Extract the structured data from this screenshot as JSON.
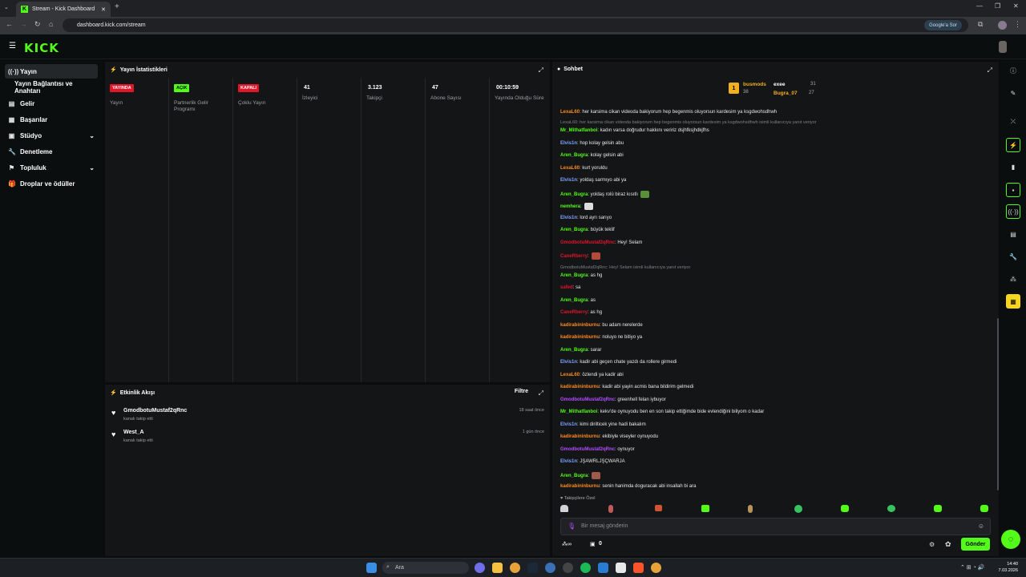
{
  "browser": {
    "tab_title": "Stream - Kick Dashboard",
    "url": "dashboard.kick.com/stream",
    "google_sor": "Google'a Sor"
  },
  "app": {
    "logo": "KICK"
  },
  "sidebar": {
    "items": [
      {
        "label": "Yayın",
        "icon": "broadcast-icon"
      },
      {
        "label": "Yayın Bağlantısı ve Anahtarı",
        "icon": ""
      },
      {
        "label": "Gelir",
        "icon": "revenue-icon"
      },
      {
        "label": "Başarılar",
        "icon": "achievements-icon"
      },
      {
        "label": "Stüdyo",
        "icon": "studio-icon"
      },
      {
        "label": "Denetleme",
        "icon": "moderation-icon"
      },
      {
        "label": "Topluluk",
        "icon": "community-icon"
      },
      {
        "label": "Droplar ve ödüller",
        "icon": "gift-icon"
      }
    ]
  },
  "stats": {
    "title": "Yayın İstatistikleri",
    "columns": [
      {
        "badge": "YAYINDA",
        "label": "Yayın",
        "badge_color": "#e0162b"
      },
      {
        "badge": "AÇIK",
        "label": "Partnerlik Gelir Programı",
        "badge_color": "#53fc18"
      },
      {
        "badge": "KAPALI",
        "label": "Çoklu Yayın",
        "badge_color": "#e0162b"
      },
      {
        "value": "41",
        "label": "İzleyici"
      },
      {
        "value": "3.123",
        "label": "Takipçi"
      },
      {
        "value": "47",
        "label": "Abone Sayısı"
      },
      {
        "value": "00:10:59",
        "label": "Yayında Olduğu Süre"
      }
    ]
  },
  "events": {
    "title": "Etkinlik Akışı",
    "filter": "Filtre",
    "items": [
      {
        "name": "GmodbotuMustaf2qRnc",
        "sub": "kanalı takip etti",
        "time": "18 saat önce"
      },
      {
        "name": "West_A",
        "sub": "kanalı takip etti",
        "time": "1 gün önce"
      }
    ]
  },
  "chat": {
    "title": "Sohbet",
    "leaderboard": {
      "rank": "1",
      "first": {
        "name": "busmods",
        "value": "38"
      },
      "second": {
        "name": "exee",
        "value": "31"
      },
      "third": {
        "name": "Bugra_07",
        "value": "27"
      }
    },
    "top_message": {
      "user": "LexaL60",
      "text": "her karsima cikan videoda bakiyorum hep begenmis oluyorsun kardesim ya ksgdwohsdhwh"
    },
    "messages": [
      {
        "type": "reply",
        "text": "LexaL60: her karsima cikan videoda bakiyorum hep begenmis oluyorsun kardesim ya ksgdwohsdhwh isimli kullanıcıya yanıt veriyor"
      },
      {
        "user": "Mr_Mithatfanboi",
        "text": ": kadın varsa doğrudur hakkını veririz dsjhfksjhdkjfhs",
        "color": "#53fc18"
      },
      {
        "user": "Elvis1n",
        "text": ": hop kolay gelsin abu",
        "color": "#7ea3ff"
      },
      {
        "user": "Aren_Bugra",
        "text": ": kolay gelsin abi",
        "color": "#53fc18"
      },
      {
        "user": "LexaL60",
        "text": ": kurt yoruldu",
        "color": "#ff8a1f"
      },
      {
        "user": "Elvis1n",
        "text": ": yoldaş sarmıyo abi ya",
        "color": "#7ea3ff"
      },
      {
        "user": "Aren_Bugra",
        "text": ": yoldaş rolü biraz kısıtlı",
        "color": "#53fc18",
        "emote": true
      },
      {
        "user": "nemhera",
        "text": ":",
        "color": "#53fc18",
        "emote": true
      },
      {
        "user": "Elvis1n",
        "text": ": lord ayrı sarıyo",
        "color": "#7ea3ff"
      },
      {
        "user": "Aren_Bugra",
        "text": ": büyük teklif",
        "color": "#53fc18"
      },
      {
        "user": "GmodbotuMustaf2qRnc",
        "text": ": Hey! Selam",
        "color": "#e0162b"
      },
      {
        "user": "CaneRberry",
        "text": ":",
        "color": "#e0162b",
        "emote": true
      },
      {
        "type": "reply",
        "text": "GmodbotuMustaf2qRnc: Hey! Selam isimli kullanıcıya yanıt veriyor"
      },
      {
        "user": "Aren_Bugra",
        "text": ": as hg",
        "color": "#53fc18"
      },
      {
        "user": "safed",
        "text": ": sa",
        "color": "#e0162b"
      },
      {
        "user": "Aren_Bugra",
        "text": ": as",
        "color": "#53fc18"
      },
      {
        "user": "CaneRberry",
        "text": ": as hg",
        "color": "#e0162b"
      },
      {
        "user": "kadirabininburnu",
        "text": ": bu adam nerelerde",
        "color": "#ff8a1f"
      },
      {
        "user": "kadirabininburnu",
        "text": ": noluyo ne bitiyo ya",
        "color": "#ff8a1f"
      },
      {
        "user": "Aren_Bugra",
        "text": ": sarar",
        "color": "#53fc18"
      },
      {
        "user": "Elvis1n",
        "text": ": kadir abi geçen chate yazdı da rollere girmedi",
        "color": "#7ea3ff"
      },
      {
        "user": "LexaL60",
        "text": ": özlendi ya kadir abi",
        "color": "#ff8a1f"
      },
      {
        "user": "kadirabininburnu",
        "text": ": kadir abi yayin acmis bana bildirim gelmedi",
        "color": "#ff8a1f"
      },
      {
        "user": "GmodbotuMustaf2qRnc",
        "text": ": greenhell felan iybuyor",
        "color": "#b44dff"
      },
      {
        "user": "Mr_Mithatfanboi",
        "text": ": kekv'de oynuyodu ben en son takip ettiğimde bide evlendiğini biliyom o kadar",
        "color": "#53fc18"
      },
      {
        "user": "Elvis1n",
        "text": ": kimi dirilticek yine hadi bakalım",
        "color": "#7ea3ff"
      },
      {
        "user": "kadirabininburnu",
        "text": ": ekibiyle viseyler oynuyodu",
        "color": "#ff8a1f"
      },
      {
        "user": "GmodbotuMustaf2qRnc",
        "text": ": oynuyor",
        "color": "#b44dff"
      },
      {
        "user": "Elvis1n",
        "text": ": JŞAWRLJŞÇWARJA",
        "color": "#7ea3ff"
      },
      {
        "user": "Aren_Bugra",
        "text": ":",
        "color": "#53fc18",
        "emote": true
      },
      {
        "user": "kadirabininburnu",
        "text": ": senin hanimda doguracak abi insallah bi ara",
        "color": "#ff8a1f"
      }
    ],
    "followers_only": "Takipçilere Özel",
    "input_placeholder": "Bir mesaj gönderin",
    "viewer_count": "0",
    "send": "Gönder"
  },
  "taskbar": {
    "search": "Ara",
    "time": "14:40",
    "date": "7.03.2026"
  }
}
